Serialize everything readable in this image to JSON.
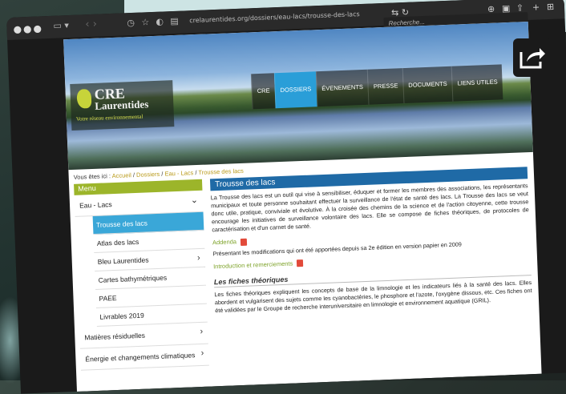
{
  "browser": {
    "url": "crelaurentides.org/dossiers/eau-lacs/trousse-des-lacs",
    "search_placeholder": "Recherche..."
  },
  "site": {
    "logo_line1": "CRE",
    "logo_line2": "Laurentides",
    "tagline": "Votre réseau environnemental",
    "nav": [
      "CRE",
      "DOSSIERS",
      "ÉVENEMENTS",
      "PRESSE",
      "DOCUMENTS",
      "LIENS UTILES"
    ],
    "nav_active": "DOSSIERS"
  },
  "breadcrumb": {
    "prefix": "Vous êtes ici :",
    "items": [
      "Accueil",
      "Dossiers",
      "Eau - Lacs",
      "Trousse des lacs"
    ]
  },
  "menu": {
    "title": "Menu",
    "section": "Eau - Lacs",
    "subitems": [
      "Trousse des lacs",
      "Atlas des lacs",
      "Bleu Laurentides",
      "Cartes bathymétriques",
      "PAEE",
      "Livrables 2019"
    ],
    "active_subitem": "Trousse des lacs",
    "other_sections": [
      "Matières résiduelles",
      "Énergie et changements climatiques"
    ]
  },
  "content": {
    "title": "Trousse des lacs",
    "intro": "La Trousse des lacs est un outil qui vise à sensibiliser, éduquer et former les membres des associations, les représentants municipaux et toute personne souhaitant effectuer la surveillance de l'état de santé des lacs. La Trousse des lacs se veut donc utile, pratique, conviviale et évolutive. À la croisée des chemins de la science et de l'action citoyenne, cette trousse encourage les initiatives de surveillance volontaire des lacs. Elle se compose de fiches théoriques, de protocoles de caractérisation et d'un carnet de santé.",
    "addenda_link": "Addenda",
    "addenda_text": "Présentant les modifications qui ont été apportées depuis sa 2e édition en version papier en 2009",
    "intro_link": "Introduction et remerciements",
    "section_title": "Les fiches théoriques",
    "section_text": "Les fiches théoriques expliquent les concepts de base de la limnologie et les indicateurs liés à la santé des lacs. Elles abordent et vulgarisent des sujets comme les cyanobactéries, le phosphore et l'azote, l'oxygène dissous, etc. Ces fiches ont été validées par le Groupe de recherche interuniversitaire en limnologie et environnement aquatique (GRIL)."
  }
}
